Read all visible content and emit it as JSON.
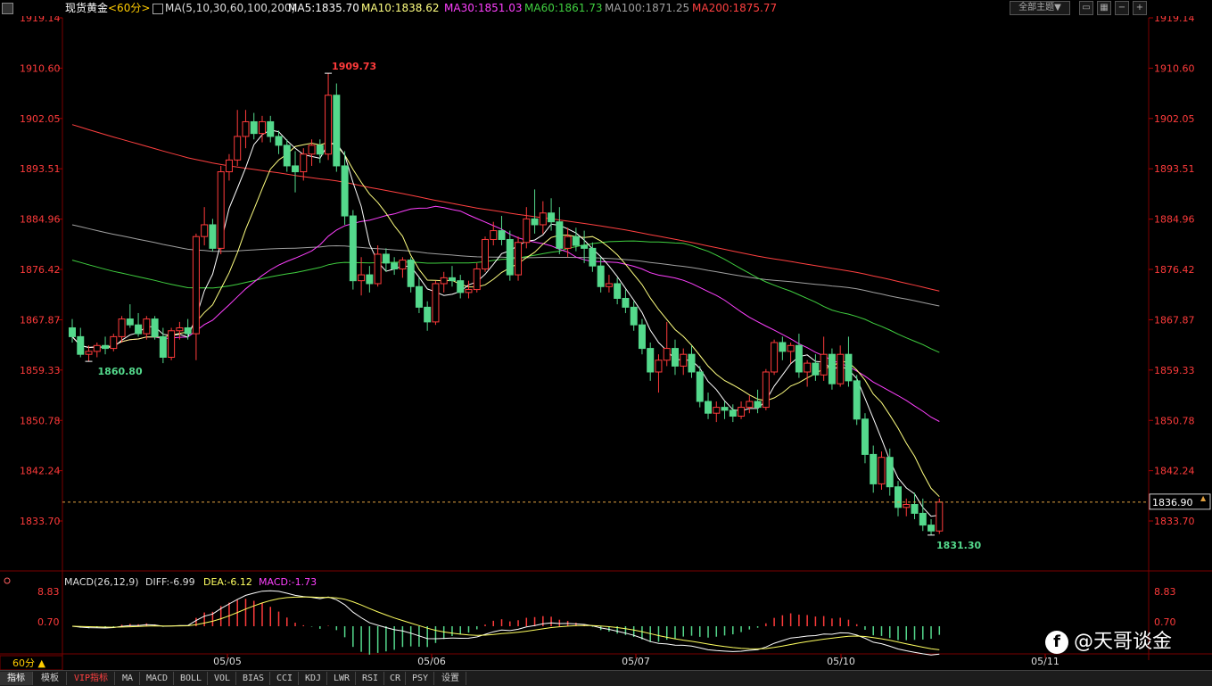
{
  "header": {
    "instrument": "现货黄金",
    "period": "<60分>",
    "ma_params": "MA(5,10,30,60,100,200)",
    "ma5": "MA5:1835.70",
    "ma10": "MA10:1838.62",
    "ma30": "MA30:1851.03",
    "ma60": "MA60:1861.73",
    "ma100": "MA100:1871.25",
    "ma200": "MA200:1875.77"
  },
  "theme_button": "全部主题▼",
  "colors": {
    "up": "#ff3b3b",
    "down": "#54d98c",
    "ma5": "#ffffff",
    "ma10": "#ffff80",
    "ma30": "#ff40ff",
    "ma60": "#40d040",
    "ma100": "#a0a0a0",
    "ma200": "#ff4040",
    "axis": "#ff3b3b"
  },
  "price_axis": [
    "1919.14",
    "1910.60",
    "1902.05",
    "1893.51",
    "1884.96",
    "1876.42",
    "1867.87",
    "1859.33",
    "1850.78",
    "1842.24",
    "1833.70"
  ],
  "price_annotations": {
    "high": "1909.73",
    "low_left": "1860.80",
    "low_right": "1831.30",
    "last": "1836.90"
  },
  "macd": {
    "title": "MACD(26,12,9)",
    "diff": "DIFF:-6.99",
    "dea": "DEA:-6.12",
    "macd": "MACD:-1.73",
    "axis": [
      "8.83",
      "0.70"
    ]
  },
  "date_axis": [
    "05/05",
    "05/06",
    "05/07",
    "05/10",
    "05/11"
  ],
  "period_selector": "60分 ▲",
  "bottom_tabs": [
    "指标",
    "模板",
    "VIP指标",
    "MA",
    "MACD",
    "BOLL",
    "VOL",
    "BIAS",
    "CCI",
    "KDJ",
    "LWR",
    "RSI",
    "CR",
    "PSY",
    "设置"
  ],
  "watermark": {
    "icon": "weibo-f-icon",
    "text": "@天哥谈金"
  },
  "chart_data": {
    "type": "candlestick",
    "ylim": [
      1828,
      1921
    ],
    "candles": [
      [
        1866.5,
        1868.0,
        1864.0,
        1865.0
      ],
      [
        1865.0,
        1866.5,
        1861.5,
        1862.0
      ],
      [
        1862.0,
        1863.5,
        1860.8,
        1862.5
      ],
      [
        1862.5,
        1864.0,
        1861.5,
        1863.5
      ],
      [
        1863.5,
        1865.0,
        1862.0,
        1863.0
      ],
      [
        1863.0,
        1865.5,
        1862.5,
        1865.0
      ],
      [
        1865.0,
        1868.5,
        1864.0,
        1868.0
      ],
      [
        1868.0,
        1870.5,
        1866.5,
        1867.0
      ],
      [
        1867.0,
        1869.0,
        1865.0,
        1865.5
      ],
      [
        1865.5,
        1868.5,
        1864.5,
        1868.0
      ],
      [
        1868.0,
        1868.5,
        1864.5,
        1865.0
      ],
      [
        1865.0,
        1866.5,
        1860.5,
        1861.5
      ],
      [
        1861.5,
        1866.5,
        1861.0,
        1866.0
      ],
      [
        1866.0,
        1867.5,
        1864.5,
        1866.5
      ],
      [
        1866.5,
        1868.0,
        1864.5,
        1865.5
      ],
      [
        1865.5,
        1882.5,
        1861.0,
        1882.0
      ],
      [
        1882.0,
        1887.0,
        1880.5,
        1884.0
      ],
      [
        1884.0,
        1885.0,
        1879.5,
        1880.0
      ],
      [
        1880.0,
        1894.0,
        1879.0,
        1893.0
      ],
      [
        1893.0,
        1896.0,
        1891.5,
        1895.0
      ],
      [
        1895.0,
        1903.5,
        1894.0,
        1899.0
      ],
      [
        1899.0,
        1903.5,
        1897.0,
        1901.5
      ],
      [
        1901.5,
        1903.0,
        1898.5,
        1899.5
      ],
      [
        1899.5,
        1902.5,
        1898.0,
        1901.5
      ],
      [
        1901.5,
        1902.5,
        1898.0,
        1899.0
      ],
      [
        1899.0,
        1900.0,
        1896.0,
        1897.5
      ],
      [
        1897.5,
        1898.5,
        1893.0,
        1894.0
      ],
      [
        1894.0,
        1896.5,
        1889.5,
        1893.0
      ],
      [
        1893.0,
        1897.0,
        1891.5,
        1896.0
      ],
      [
        1896.0,
        1898.5,
        1894.0,
        1897.5
      ],
      [
        1897.5,
        1898.5,
        1894.5,
        1896.0
      ],
      [
        1896.0,
        1909.73,
        1895.0,
        1906.0
      ],
      [
        1906.0,
        1908.0,
        1893.0,
        1894.0
      ],
      [
        1894.0,
        1896.5,
        1884.0,
        1885.5
      ],
      [
        1885.5,
        1886.5,
        1873.0,
        1874.5
      ],
      [
        1874.5,
        1878.5,
        1872.0,
        1875.5
      ],
      [
        1875.5,
        1877.0,
        1872.5,
        1874.0
      ],
      [
        1874.0,
        1880.5,
        1873.5,
        1879.0
      ],
      [
        1879.0,
        1880.0,
        1876.0,
        1877.5
      ],
      [
        1877.5,
        1878.5,
        1875.5,
        1876.5
      ],
      [
        1876.5,
        1878.5,
        1875.0,
        1878.0
      ],
      [
        1878.0,
        1878.5,
        1872.5,
        1873.5
      ],
      [
        1873.5,
        1875.0,
        1869.0,
        1870.0
      ],
      [
        1870.0,
        1871.0,
        1866.0,
        1867.5
      ],
      [
        1867.5,
        1874.5,
        1867.0,
        1874.0
      ],
      [
        1874.0,
        1876.0,
        1872.5,
        1875.0
      ],
      [
        1875.0,
        1877.0,
        1873.5,
        1874.5
      ],
      [
        1874.5,
        1875.5,
        1871.5,
        1872.5
      ],
      [
        1872.5,
        1874.5,
        1871.5,
        1873.0
      ],
      [
        1873.0,
        1877.5,
        1872.5,
        1876.5
      ],
      [
        1876.5,
        1882.0,
        1876.0,
        1881.5
      ],
      [
        1881.5,
        1884.5,
        1880.5,
        1883.0
      ],
      [
        1883.0,
        1885.5,
        1880.5,
        1881.5
      ],
      [
        1881.5,
        1883.0,
        1874.5,
        1875.5
      ],
      [
        1875.5,
        1882.0,
        1874.5,
        1881.0
      ],
      [
        1881.0,
        1887.0,
        1880.0,
        1885.0
      ],
      [
        1885.0,
        1890.0,
        1882.5,
        1884.0
      ],
      [
        1884.0,
        1888.0,
        1882.5,
        1886.0
      ],
      [
        1886.0,
        1888.5,
        1883.0,
        1884.5
      ],
      [
        1884.5,
        1887.0,
        1879.0,
        1880.0
      ],
      [
        1880.0,
        1883.5,
        1878.5,
        1882.0
      ],
      [
        1882.0,
        1883.5,
        1879.5,
        1880.5
      ],
      [
        1880.5,
        1883.0,
        1877.5,
        1880.0
      ],
      [
        1880.0,
        1881.0,
        1876.0,
        1877.0
      ],
      [
        1877.0,
        1878.5,
        1872.5,
        1873.5
      ],
      [
        1873.5,
        1875.5,
        1872.5,
        1874.0
      ],
      [
        1874.0,
        1875.0,
        1870.5,
        1871.5
      ],
      [
        1871.5,
        1873.0,
        1869.0,
        1870.0
      ],
      [
        1870.0,
        1871.0,
        1866.0,
        1867.0
      ],
      [
        1867.0,
        1868.0,
        1862.0,
        1863.0
      ],
      [
        1863.0,
        1864.0,
        1857.5,
        1859.0
      ],
      [
        1859.0,
        1862.0,
        1855.5,
        1861.0
      ],
      [
        1861.0,
        1867.5,
        1860.0,
        1863.0
      ],
      [
        1863.0,
        1864.5,
        1858.5,
        1860.0
      ],
      [
        1860.0,
        1863.0,
        1858.5,
        1862.0
      ],
      [
        1862.0,
        1863.5,
        1858.0,
        1859.0
      ],
      [
        1859.0,
        1860.0,
        1853.0,
        1854.0
      ],
      [
        1854.0,
        1855.5,
        1851.0,
        1852.0
      ],
      [
        1852.0,
        1854.0,
        1850.5,
        1853.0
      ],
      [
        1853.0,
        1854.0,
        1851.0,
        1852.5
      ],
      [
        1852.5,
        1853.5,
        1850.5,
        1851.5
      ],
      [
        1851.5,
        1854.0,
        1851.0,
        1853.0
      ],
      [
        1853.0,
        1855.0,
        1852.0,
        1854.0
      ],
      [
        1854.0,
        1856.0,
        1852.0,
        1853.0
      ],
      [
        1853.0,
        1859.5,
        1852.5,
        1859.0
      ],
      [
        1859.0,
        1864.5,
        1858.5,
        1864.0
      ],
      [
        1864.0,
        1865.0,
        1861.0,
        1862.5
      ],
      [
        1862.5,
        1864.0,
        1860.5,
        1863.5
      ],
      [
        1863.5,
        1865.5,
        1858.0,
        1859.0
      ],
      [
        1859.0,
        1861.0,
        1856.5,
        1860.5
      ],
      [
        1860.5,
        1862.0,
        1857.5,
        1858.5
      ],
      [
        1858.5,
        1865.0,
        1857.5,
        1862.0
      ],
      [
        1862.0,
        1863.0,
        1856.0,
        1857.0
      ],
      [
        1857.0,
        1863.5,
        1856.5,
        1862.0
      ],
      [
        1862.0,
        1865.0,
        1856.5,
        1857.5
      ],
      [
        1857.5,
        1858.5,
        1850.0,
        1851.0
      ],
      [
        1851.0,
        1852.0,
        1843.5,
        1845.0
      ],
      [
        1845.0,
        1846.5,
        1838.5,
        1840.0
      ],
      [
        1840.0,
        1845.5,
        1839.0,
        1844.5
      ],
      [
        1844.5,
        1846.0,
        1838.0,
        1839.5
      ],
      [
        1839.5,
        1840.5,
        1834.5,
        1836.0
      ],
      [
        1836.0,
        1837.5,
        1834.5,
        1836.5
      ],
      [
        1836.5,
        1838.5,
        1834.0,
        1835.0
      ],
      [
        1835.0,
        1837.5,
        1832.0,
        1833.0
      ],
      [
        1833.0,
        1834.0,
        1831.3,
        1832.0
      ],
      [
        1832.0,
        1837.5,
        1831.5,
        1836.9
      ]
    ]
  }
}
